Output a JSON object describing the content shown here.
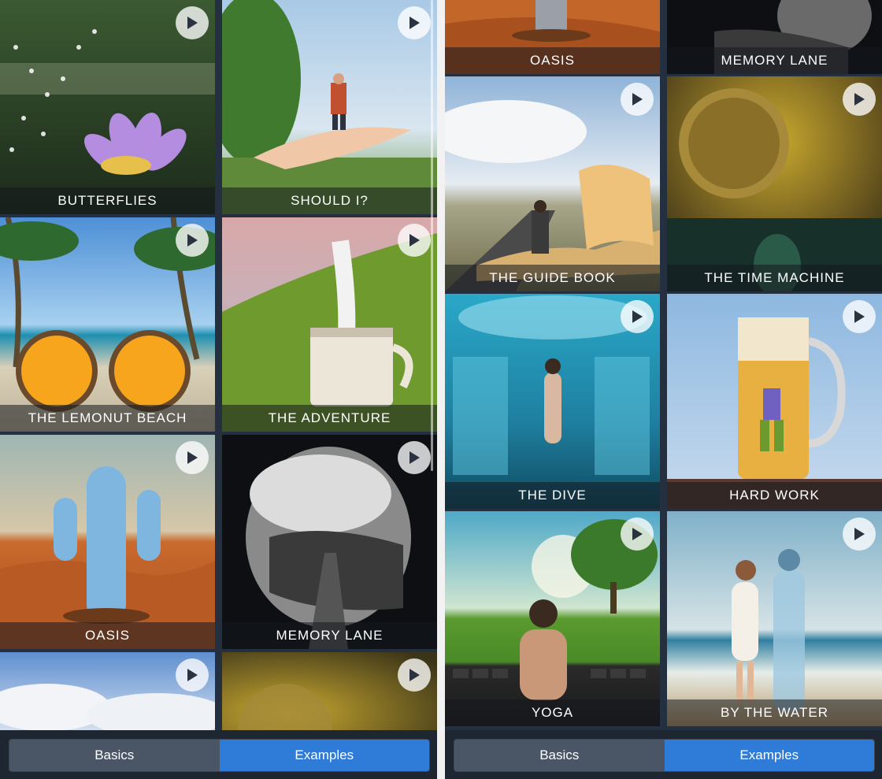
{
  "left_panel": {
    "tiles": [
      {
        "label": "BUTTERFLIES"
      },
      {
        "label": "SHOULD I?"
      },
      {
        "label": "THE LEMONUT BEACH"
      },
      {
        "label": "THE ADVENTURE"
      },
      {
        "label": "OASIS"
      },
      {
        "label": "MEMORY LANE"
      },
      {
        "label": ""
      },
      {
        "label": ""
      }
    ],
    "tabs": {
      "basics": "Basics",
      "examples": "Examples"
    }
  },
  "right_panel": {
    "tiles": [
      {
        "label": "OASIS"
      },
      {
        "label": "MEMORY LANE"
      },
      {
        "label": "THE GUIDE BOOK"
      },
      {
        "label": "THE TIME MACHINE"
      },
      {
        "label": "THE DIVE"
      },
      {
        "label": "HARD WORK"
      },
      {
        "label": "YOGA"
      },
      {
        "label": "BY THE WATER"
      }
    ],
    "tabs": {
      "basics": "Basics",
      "examples": "Examples"
    }
  },
  "colors": {
    "active_tab": "#2f7bd8",
    "inactive_tab": "#4a5565",
    "background": "#243040"
  },
  "icons": {
    "play": "play-icon"
  }
}
